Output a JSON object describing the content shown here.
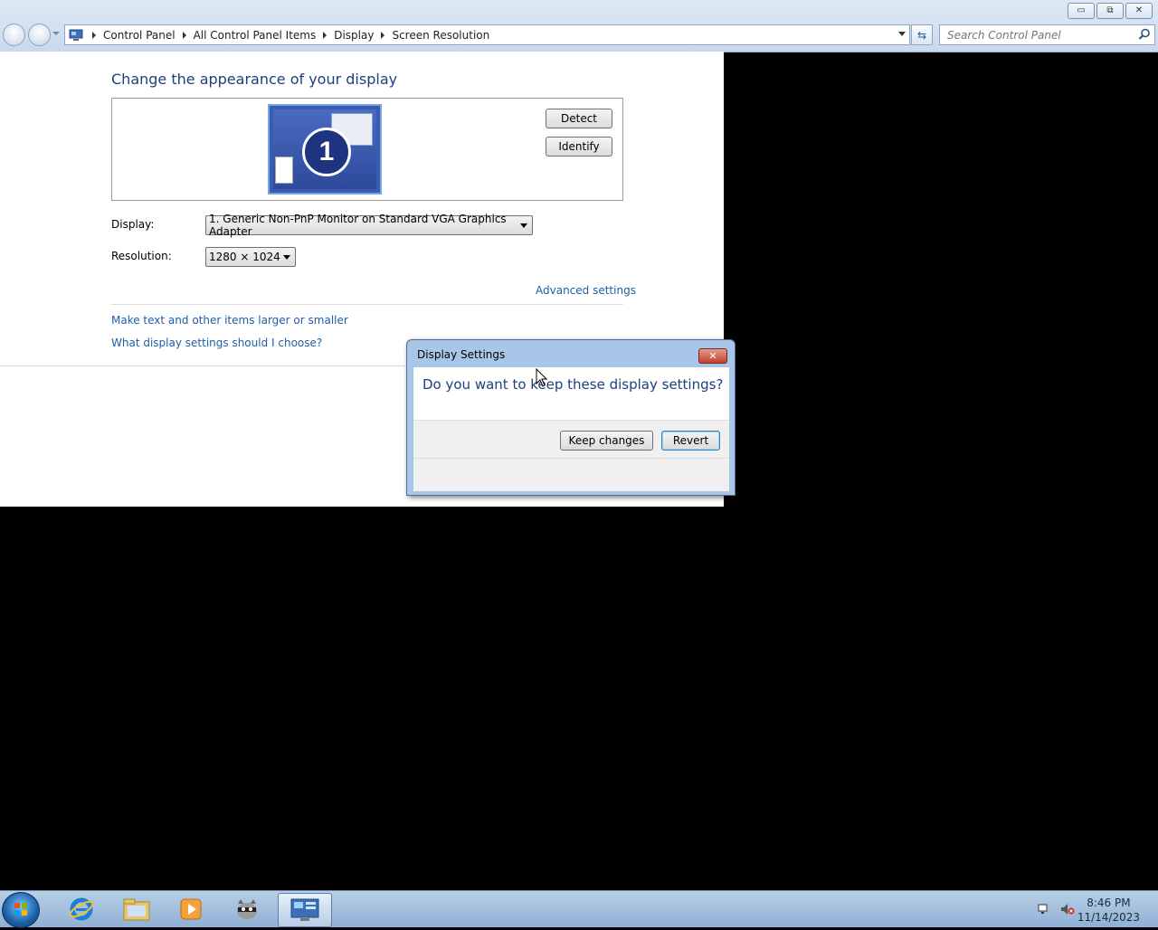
{
  "window": {
    "controls": {
      "minimize": "▭",
      "restore": "⧉",
      "close": "✕"
    }
  },
  "address": {
    "breadcrumbs": [
      "Control Panel",
      "All Control Panel Items",
      "Display",
      "Screen Resolution"
    ],
    "search_placeholder": "Search Control Panel"
  },
  "content": {
    "heading": "Change the appearance of your display",
    "monitor_number": "1",
    "detect_label": "Detect",
    "identify_label": "Identify",
    "display_label": "Display:",
    "display_value": "1. Generic Non-PnP Monitor on Standard VGA Graphics Adapter",
    "resolution_label": "Resolution:",
    "resolution_value": "1280 × 1024",
    "advanced_link": "Advanced settings",
    "link_text_size": "Make text and other items larger or smaller",
    "link_help": "What display settings should I choose?"
  },
  "dialog": {
    "title": "Display Settings",
    "close": "✕",
    "question": "Do you want to keep these display settings?",
    "keep_label": "Keep changes",
    "revert_label": "Revert"
  },
  "taskbar": {
    "time": "8:46 PM",
    "date": "11/14/2023"
  },
  "colors": {
    "link": "#1e5ea6",
    "heading": "#1e3f7e"
  }
}
